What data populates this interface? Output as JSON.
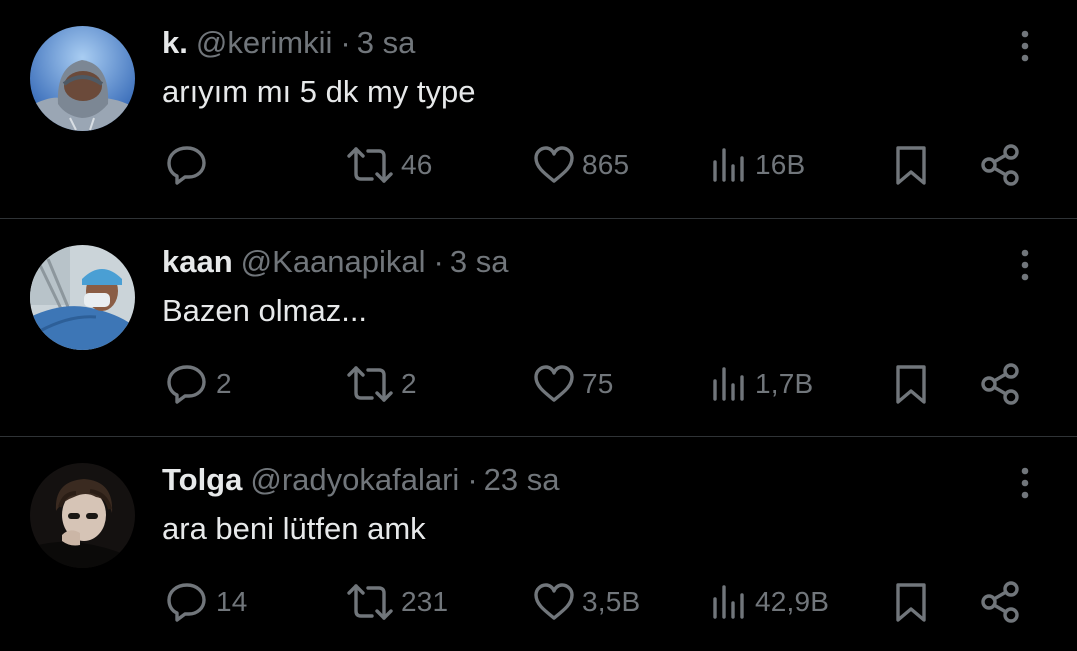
{
  "tweets": [
    {
      "name": "k.",
      "handle": "@kerimkii",
      "separator": "·",
      "time": "3 sa",
      "text": "arıyım mı 5 dk my type",
      "replies": "",
      "retweets": "46",
      "likes": "865",
      "views": "16B",
      "avatar_colors": [
        "#5b8fd8",
        "#2f5ea8"
      ]
    },
    {
      "name": "kaan",
      "handle": "@Kaanapikal",
      "separator": "·",
      "time": "3 sa",
      "text": "Bazen olmaz...",
      "replies": "2",
      "retweets": "2",
      "likes": "75",
      "views": "1,7B",
      "avatar_colors": [
        "#c9d6df",
        "#3f78b8"
      ]
    },
    {
      "name": "Tolga",
      "handle": "@radyokafalari",
      "separator": "·",
      "time": "23 sa",
      "text": "ara beni lütfen amk",
      "replies": "14",
      "retweets": "231",
      "likes": "3,5B",
      "views": "42,9B",
      "avatar_colors": [
        "#1a1512",
        "#d8c6b8"
      ]
    }
  ],
  "colors": {
    "background": "#000000",
    "primary_text": "#e7e9ea",
    "secondary_text": "#71767b",
    "divider": "#2f3336"
  }
}
